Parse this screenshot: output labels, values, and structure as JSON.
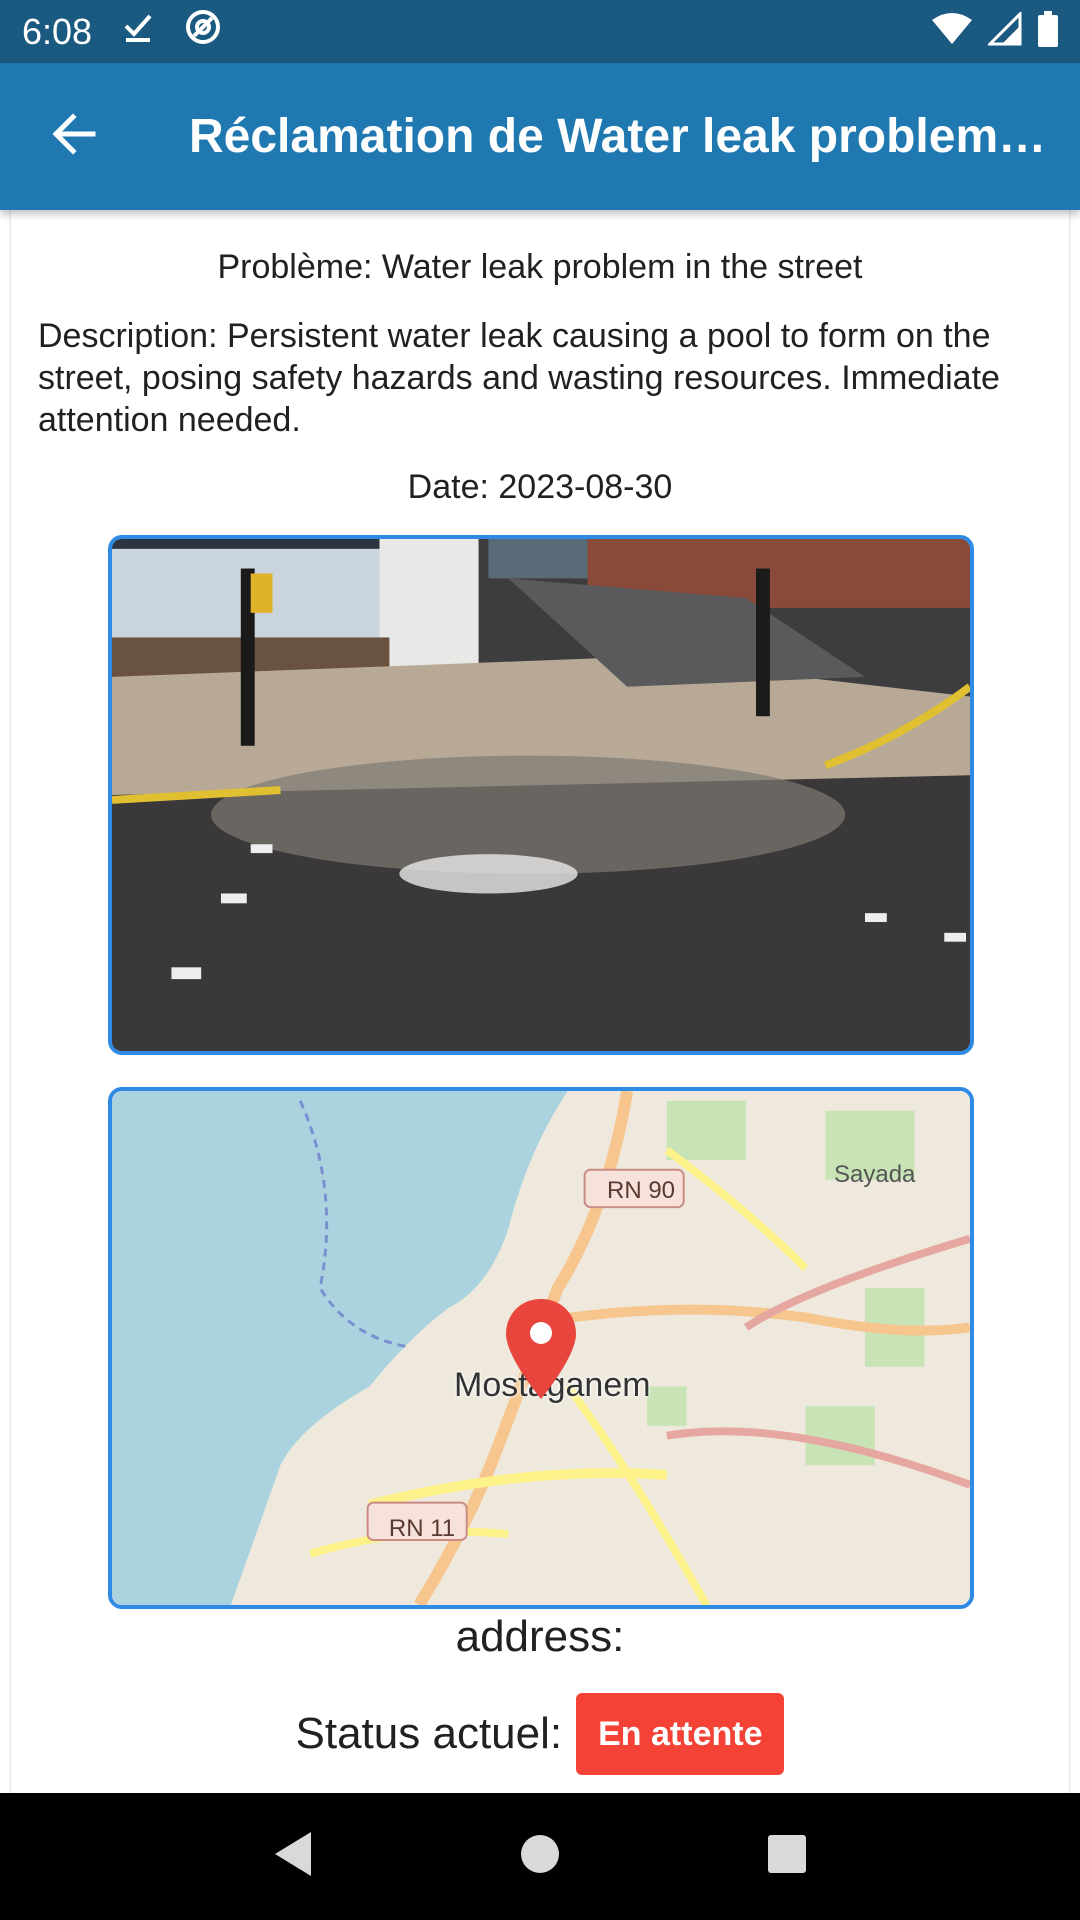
{
  "status_bar": {
    "time": "6:08",
    "icons_left": [
      "download-done-icon",
      "at-sync-icon"
    ],
    "icons_right": [
      "wifi-icon",
      "signal-icon",
      "battery-icon"
    ]
  },
  "app_bar": {
    "title": "Réclamation de Water leak problem in the street",
    "back_icon": "arrow-left-icon",
    "color": "#1f78b0"
  },
  "complaint": {
    "problem": "Problème: Water leak problem in the street",
    "description": "Description: Persistent water leak causing a pool to form on the street, posing safety hazards and wasting resources. Immediate attention needed.",
    "date": "Date: 2023-08-30"
  },
  "map": {
    "labels": {
      "city": "Mostaganem",
      "town": "Sayada",
      "road_1": "RN 90",
      "road_2": "RN 11"
    },
    "marker_icon": "map-pin-icon",
    "marker_color": "#e8453c"
  },
  "address_label": "address:",
  "status": {
    "label": "Status actuel:",
    "value": "En attente",
    "badge_color": "#f44336"
  },
  "nav_bar": {
    "icons": [
      "back-triangle-icon",
      "home-circle-icon",
      "recents-square-icon"
    ]
  }
}
